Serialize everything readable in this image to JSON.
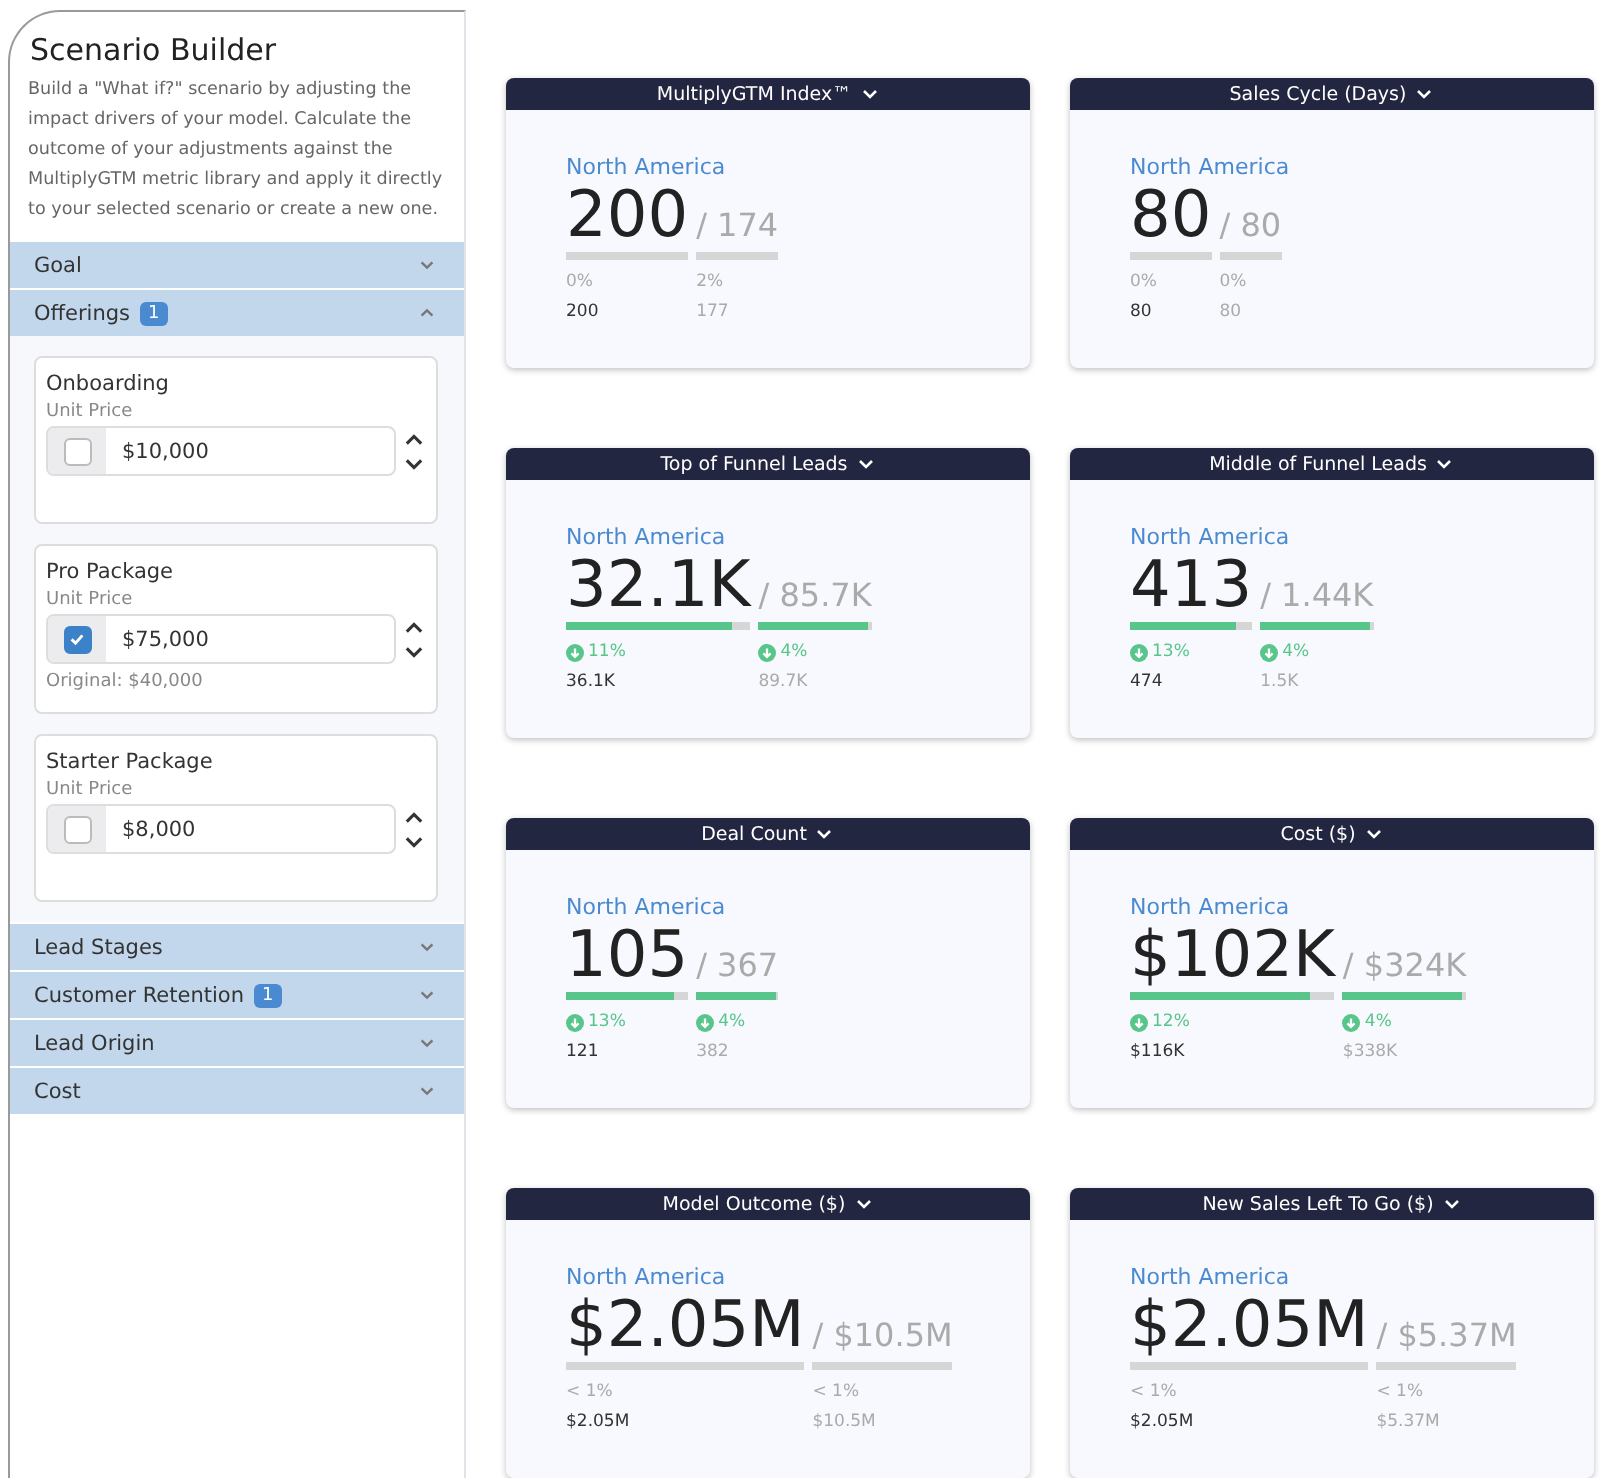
{
  "sidebar": {
    "title": "Scenario Builder",
    "description": "Build a \"What if?\" scenario by adjusting the impact drivers of your model. Calculate the outcome of your adjustments against the MultiplyGTM metric library and apply it directly to your selected scenario or create a new one.",
    "sections": [
      {
        "label": "Goal",
        "expanded": false
      },
      {
        "label": "Offerings",
        "badge": "1",
        "expanded": true,
        "items": [
          {
            "name": "Onboarding",
            "field_label": "Unit Price",
            "checked": false,
            "value": "$10,000"
          },
          {
            "name": "Pro Package",
            "field_label": "Unit Price",
            "checked": true,
            "value": "$75,000",
            "note": "Original: $40,000"
          },
          {
            "name": "Starter Package",
            "field_label": "Unit Price",
            "checked": false,
            "value": "$8,000"
          }
        ]
      },
      {
        "label": "Lead Stages",
        "expanded": false
      },
      {
        "label": "Customer Retention",
        "badge": "1",
        "expanded": false
      },
      {
        "label": "Lead Origin",
        "expanded": false
      },
      {
        "label": "Cost",
        "expanded": false
      }
    ]
  },
  "cards": [
    {
      "title": "MultiplyGTM Index™",
      "region": "North America",
      "value": "200",
      "target": "/ 174",
      "bars": [
        {
          "kind": "flat",
          "delta": "0%",
          "base": "200"
        },
        {
          "kind": "flat",
          "delta": "2%",
          "base": "177"
        }
      ]
    },
    {
      "title": "Sales Cycle (Days)",
      "region": "North America",
      "value": "80",
      "target": "/ 80",
      "bars": [
        {
          "kind": "flat",
          "delta": "0%",
          "base": "80"
        },
        {
          "kind": "flat",
          "delta": "0%",
          "base": "80"
        }
      ]
    },
    {
      "title": "Top of Funnel Leads",
      "region": "North America",
      "value": "32.1K",
      "target": "/ 85.7K",
      "bars": [
        {
          "level": 0.9,
          "kind": "down",
          "delta": "11%",
          "base": "36.1K"
        },
        {
          "level": 0.97,
          "kind": "down",
          "delta": "4%",
          "base": "89.7K"
        }
      ]
    },
    {
      "title": "Middle of Funnel Leads",
      "region": "North America",
      "value": "413",
      "target": "/ 1.44K",
      "bars": [
        {
          "level": 0.87,
          "kind": "down",
          "delta": "13%",
          "base": "474"
        },
        {
          "level": 0.97,
          "kind": "down",
          "delta": "4%",
          "base": "1.5K"
        }
      ]
    },
    {
      "title": "Deal Count",
      "region": "North America",
      "value": "105",
      "target": "/ 367",
      "bars": [
        {
          "level": 0.88,
          "kind": "down",
          "delta": "13%",
          "base": "121"
        },
        {
          "level": 0.97,
          "kind": "down",
          "delta": "4%",
          "base": "382"
        }
      ]
    },
    {
      "title": "Cost ($)",
      "region": "North America",
      "value": "$102K",
      "target": "/ $324K",
      "bars": [
        {
          "level": 0.88,
          "kind": "down",
          "delta": "12%",
          "base": "$116K"
        },
        {
          "level": 0.97,
          "kind": "down",
          "delta": "4%",
          "base": "$338K"
        }
      ]
    },
    {
      "title": "Model Outcome ($)",
      "region": "North America",
      "value": "$2.05M",
      "target": "/ $10.5M",
      "bars": [
        {
          "kind": "flat",
          "delta": "< 1%",
          "base": "$2.05M"
        },
        {
          "kind": "flat",
          "delta": "< 1%",
          "base": "$10.5M"
        }
      ]
    },
    {
      "title": "New Sales Left To Go ($)",
      "region": "North America",
      "value": "$2.05M",
      "target": "/ $5.37M",
      "bars": [
        {
          "kind": "flat",
          "delta": "< 1%",
          "base": "$2.05M"
        },
        {
          "kind": "flat",
          "delta": "< 1%",
          "base": "$5.37M"
        }
      ]
    }
  ]
}
